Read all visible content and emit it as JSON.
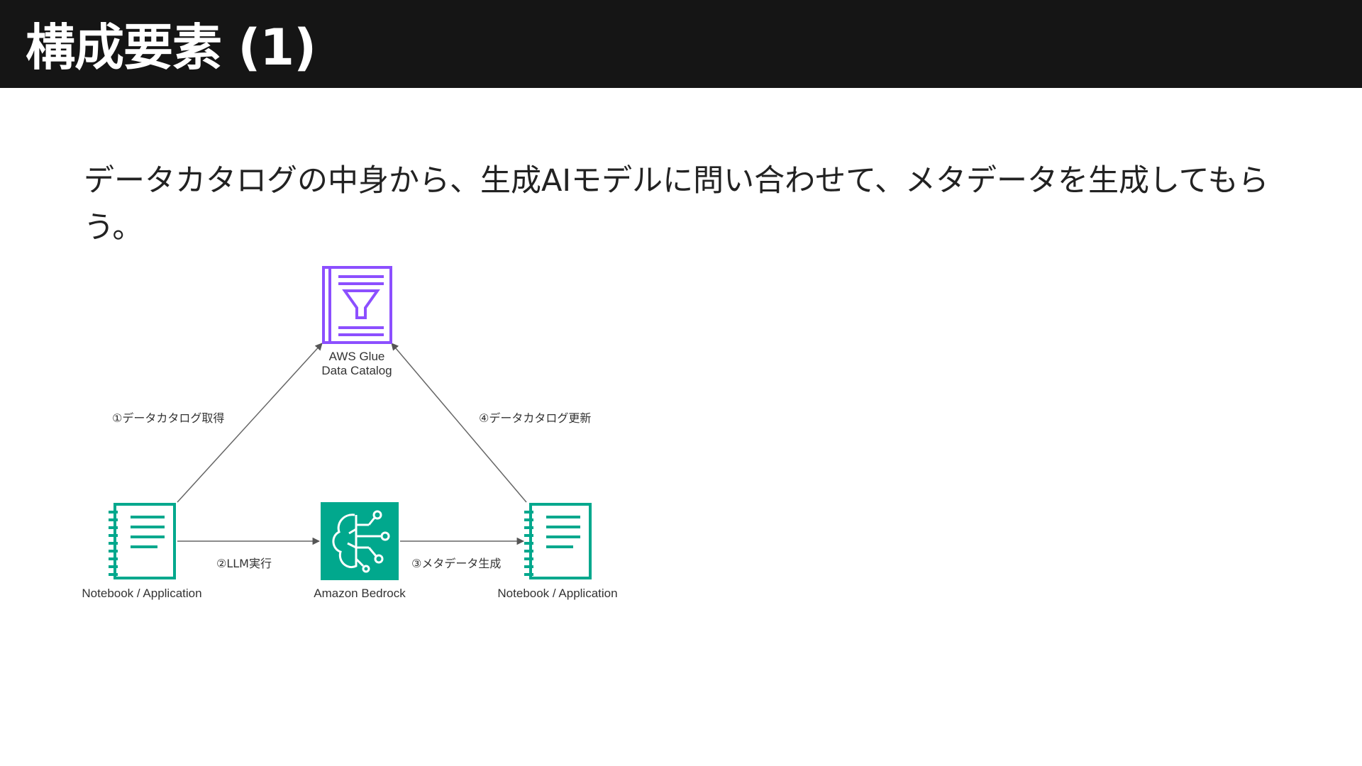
{
  "slide": {
    "title": "構成要素 (1)",
    "body": "データカタログの中身から、生成AIモデルに問い合わせて、メタデータを生成してもらう。"
  },
  "diagram": {
    "nodes": {
      "glue": {
        "label_line1": "AWS Glue",
        "label_line2": "Data Catalog",
        "color": "#8C4FFF"
      },
      "notebook_left": {
        "label": "Notebook / Application",
        "color": "#01A88D"
      },
      "bedrock": {
        "label": "Amazon Bedrock",
        "color": "#01A88D"
      },
      "notebook_right": {
        "label": "Notebook / Application",
        "color": "#01A88D"
      }
    },
    "edges": {
      "step1": "①データカタログ取得",
      "step2": "②LLM実行",
      "step3": "③メタデータ生成",
      "step4": "④データカタログ更新"
    }
  }
}
